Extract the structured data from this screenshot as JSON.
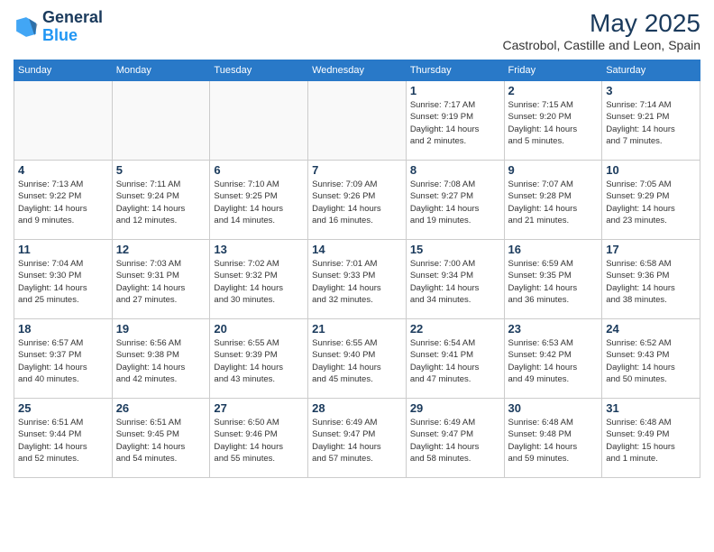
{
  "logo": {
    "line1": "General",
    "line2": "Blue"
  },
  "title": "May 2025",
  "subtitle": "Castrobol, Castille and Leon, Spain",
  "days_of_week": [
    "Sunday",
    "Monday",
    "Tuesday",
    "Wednesday",
    "Thursday",
    "Friday",
    "Saturday"
  ],
  "weeks": [
    [
      {
        "day": "",
        "detail": ""
      },
      {
        "day": "",
        "detail": ""
      },
      {
        "day": "",
        "detail": ""
      },
      {
        "day": "",
        "detail": ""
      },
      {
        "day": "1",
        "detail": "Sunrise: 7:17 AM\nSunset: 9:19 PM\nDaylight: 14 hours\nand 2 minutes."
      },
      {
        "day": "2",
        "detail": "Sunrise: 7:15 AM\nSunset: 9:20 PM\nDaylight: 14 hours\nand 5 minutes."
      },
      {
        "day": "3",
        "detail": "Sunrise: 7:14 AM\nSunset: 9:21 PM\nDaylight: 14 hours\nand 7 minutes."
      }
    ],
    [
      {
        "day": "4",
        "detail": "Sunrise: 7:13 AM\nSunset: 9:22 PM\nDaylight: 14 hours\nand 9 minutes."
      },
      {
        "day": "5",
        "detail": "Sunrise: 7:11 AM\nSunset: 9:24 PM\nDaylight: 14 hours\nand 12 minutes."
      },
      {
        "day": "6",
        "detail": "Sunrise: 7:10 AM\nSunset: 9:25 PM\nDaylight: 14 hours\nand 14 minutes."
      },
      {
        "day": "7",
        "detail": "Sunrise: 7:09 AM\nSunset: 9:26 PM\nDaylight: 14 hours\nand 16 minutes."
      },
      {
        "day": "8",
        "detail": "Sunrise: 7:08 AM\nSunset: 9:27 PM\nDaylight: 14 hours\nand 19 minutes."
      },
      {
        "day": "9",
        "detail": "Sunrise: 7:07 AM\nSunset: 9:28 PM\nDaylight: 14 hours\nand 21 minutes."
      },
      {
        "day": "10",
        "detail": "Sunrise: 7:05 AM\nSunset: 9:29 PM\nDaylight: 14 hours\nand 23 minutes."
      }
    ],
    [
      {
        "day": "11",
        "detail": "Sunrise: 7:04 AM\nSunset: 9:30 PM\nDaylight: 14 hours\nand 25 minutes."
      },
      {
        "day": "12",
        "detail": "Sunrise: 7:03 AM\nSunset: 9:31 PM\nDaylight: 14 hours\nand 27 minutes."
      },
      {
        "day": "13",
        "detail": "Sunrise: 7:02 AM\nSunset: 9:32 PM\nDaylight: 14 hours\nand 30 minutes."
      },
      {
        "day": "14",
        "detail": "Sunrise: 7:01 AM\nSunset: 9:33 PM\nDaylight: 14 hours\nand 32 minutes."
      },
      {
        "day": "15",
        "detail": "Sunrise: 7:00 AM\nSunset: 9:34 PM\nDaylight: 14 hours\nand 34 minutes."
      },
      {
        "day": "16",
        "detail": "Sunrise: 6:59 AM\nSunset: 9:35 PM\nDaylight: 14 hours\nand 36 minutes."
      },
      {
        "day": "17",
        "detail": "Sunrise: 6:58 AM\nSunset: 9:36 PM\nDaylight: 14 hours\nand 38 minutes."
      }
    ],
    [
      {
        "day": "18",
        "detail": "Sunrise: 6:57 AM\nSunset: 9:37 PM\nDaylight: 14 hours\nand 40 minutes."
      },
      {
        "day": "19",
        "detail": "Sunrise: 6:56 AM\nSunset: 9:38 PM\nDaylight: 14 hours\nand 42 minutes."
      },
      {
        "day": "20",
        "detail": "Sunrise: 6:55 AM\nSunset: 9:39 PM\nDaylight: 14 hours\nand 43 minutes."
      },
      {
        "day": "21",
        "detail": "Sunrise: 6:55 AM\nSunset: 9:40 PM\nDaylight: 14 hours\nand 45 minutes."
      },
      {
        "day": "22",
        "detail": "Sunrise: 6:54 AM\nSunset: 9:41 PM\nDaylight: 14 hours\nand 47 minutes."
      },
      {
        "day": "23",
        "detail": "Sunrise: 6:53 AM\nSunset: 9:42 PM\nDaylight: 14 hours\nand 49 minutes."
      },
      {
        "day": "24",
        "detail": "Sunrise: 6:52 AM\nSunset: 9:43 PM\nDaylight: 14 hours\nand 50 minutes."
      }
    ],
    [
      {
        "day": "25",
        "detail": "Sunrise: 6:51 AM\nSunset: 9:44 PM\nDaylight: 14 hours\nand 52 minutes."
      },
      {
        "day": "26",
        "detail": "Sunrise: 6:51 AM\nSunset: 9:45 PM\nDaylight: 14 hours\nand 54 minutes."
      },
      {
        "day": "27",
        "detail": "Sunrise: 6:50 AM\nSunset: 9:46 PM\nDaylight: 14 hours\nand 55 minutes."
      },
      {
        "day": "28",
        "detail": "Sunrise: 6:49 AM\nSunset: 9:47 PM\nDaylight: 14 hours\nand 57 minutes."
      },
      {
        "day": "29",
        "detail": "Sunrise: 6:49 AM\nSunset: 9:47 PM\nDaylight: 14 hours\nand 58 minutes."
      },
      {
        "day": "30",
        "detail": "Sunrise: 6:48 AM\nSunset: 9:48 PM\nDaylight: 14 hours\nand 59 minutes."
      },
      {
        "day": "31",
        "detail": "Sunrise: 6:48 AM\nSunset: 9:49 PM\nDaylight: 15 hours\nand 1 minute."
      }
    ]
  ]
}
